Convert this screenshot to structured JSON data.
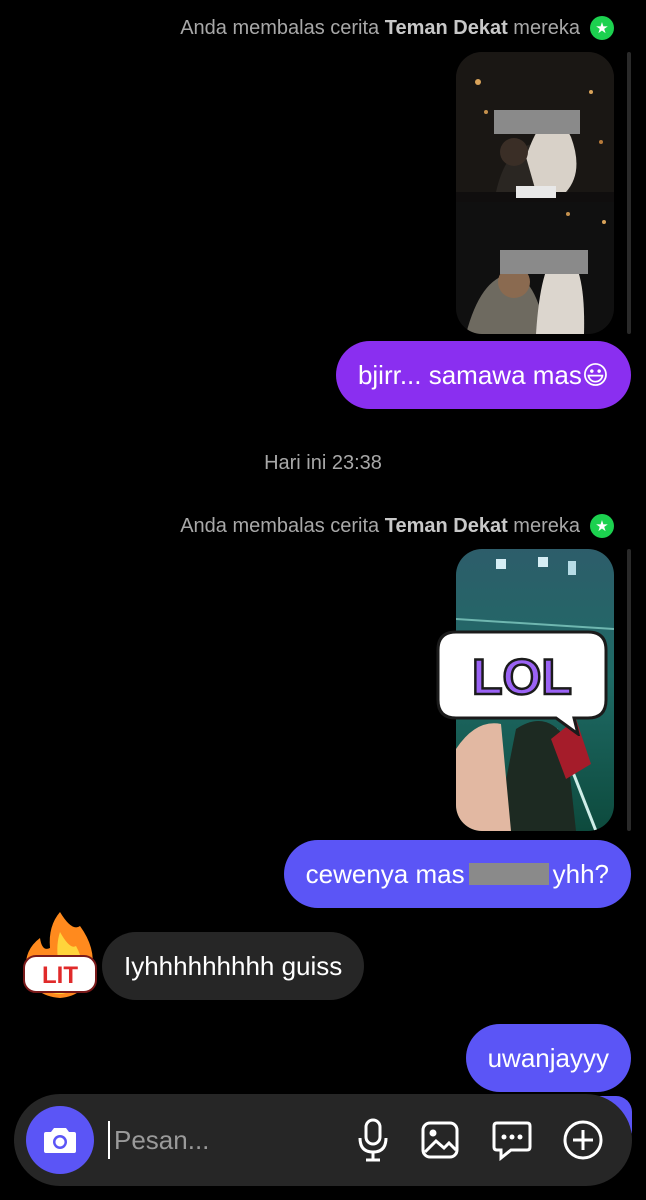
{
  "thread": {
    "reply_note_1": {
      "prefix": "Anda membalas cerita ",
      "bold": "Teman Dekat",
      "suffix": " mereka"
    },
    "message_1": "bjirr... samawa mas😃",
    "timestamp": "Hari ini 23:38",
    "reply_note_2": {
      "prefix": "Anda membalas cerita ",
      "bold": "Teman Dekat",
      "suffix": " mereka"
    },
    "sticker_text": "LOL",
    "message_2_before": "cewenya mas ",
    "message_2_after": " yhh?",
    "incoming_message": "Iyhhhhhhhhh guiss",
    "incoming_sticker_text": "LIT",
    "message_3": "uwanjayyy"
  },
  "composer": {
    "placeholder": "Pesan...",
    "icons": [
      "camera-icon",
      "microphone-icon",
      "gallery-icon",
      "sticker-chat-icon",
      "add-plus-icon"
    ]
  },
  "colors": {
    "background": "#000000",
    "bubble_purple": "#8a2ff0",
    "bubble_indigo": "#5b55f6",
    "bubble_incoming": "#262626",
    "close_friends_badge": "#1cd14f"
  }
}
